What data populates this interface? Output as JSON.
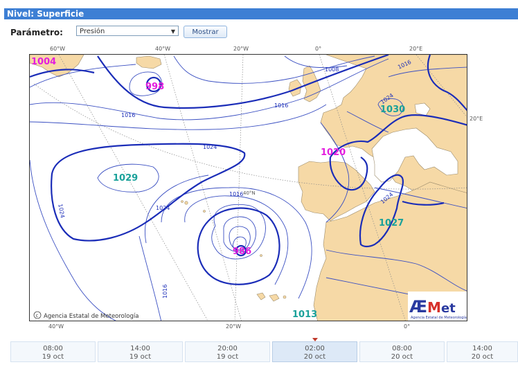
{
  "header": {
    "title": "Nivel: Superficie"
  },
  "controls": {
    "param_label": "Parámetro:",
    "param_value": "Presión",
    "show_label": "Mostrar"
  },
  "map": {
    "lon_labels_top": [
      "60°W",
      "40°W",
      "20°W",
      "0°",
      "20°E"
    ],
    "lon_labels_bottom": [
      "40°W",
      "20°W",
      "0°"
    ],
    "lon_label_right": "20°E",
    "lat_label": "40°N",
    "high_labels": [
      "1029",
      "1030",
      "1027",
      "1013"
    ],
    "low_labels": [
      "1004",
      "998",
      "986",
      "1020"
    ],
    "isobar_labels": [
      "1008",
      "1016",
      "1016",
      "1024",
      "1024",
      "1024",
      "1016",
      "1024",
      "1016",
      "1024"
    ],
    "credit": "Agencia Estatal de Meteorología",
    "logo": {
      "text": "AEMet",
      "caption": "Agencia Estatal de Meteorología"
    },
    "colors": {
      "land": "#f6d9a6",
      "sea": "#ffffff",
      "isobar": "#3a4fc2",
      "isobar_bold": "#1b2db8",
      "high": "#1aa19a",
      "low": "#e31ddf"
    }
  },
  "timeline": [
    {
      "time": "08:00",
      "date": "19 oct"
    },
    {
      "time": "14:00",
      "date": "19 oct"
    },
    {
      "time": "20:00",
      "date": "19 oct"
    },
    {
      "time": "02:00",
      "date": "20 oct",
      "selected": true
    },
    {
      "time": "08:00",
      "date": "20 oct"
    },
    {
      "time": "14:00",
      "date": "20 oct"
    }
  ]
}
